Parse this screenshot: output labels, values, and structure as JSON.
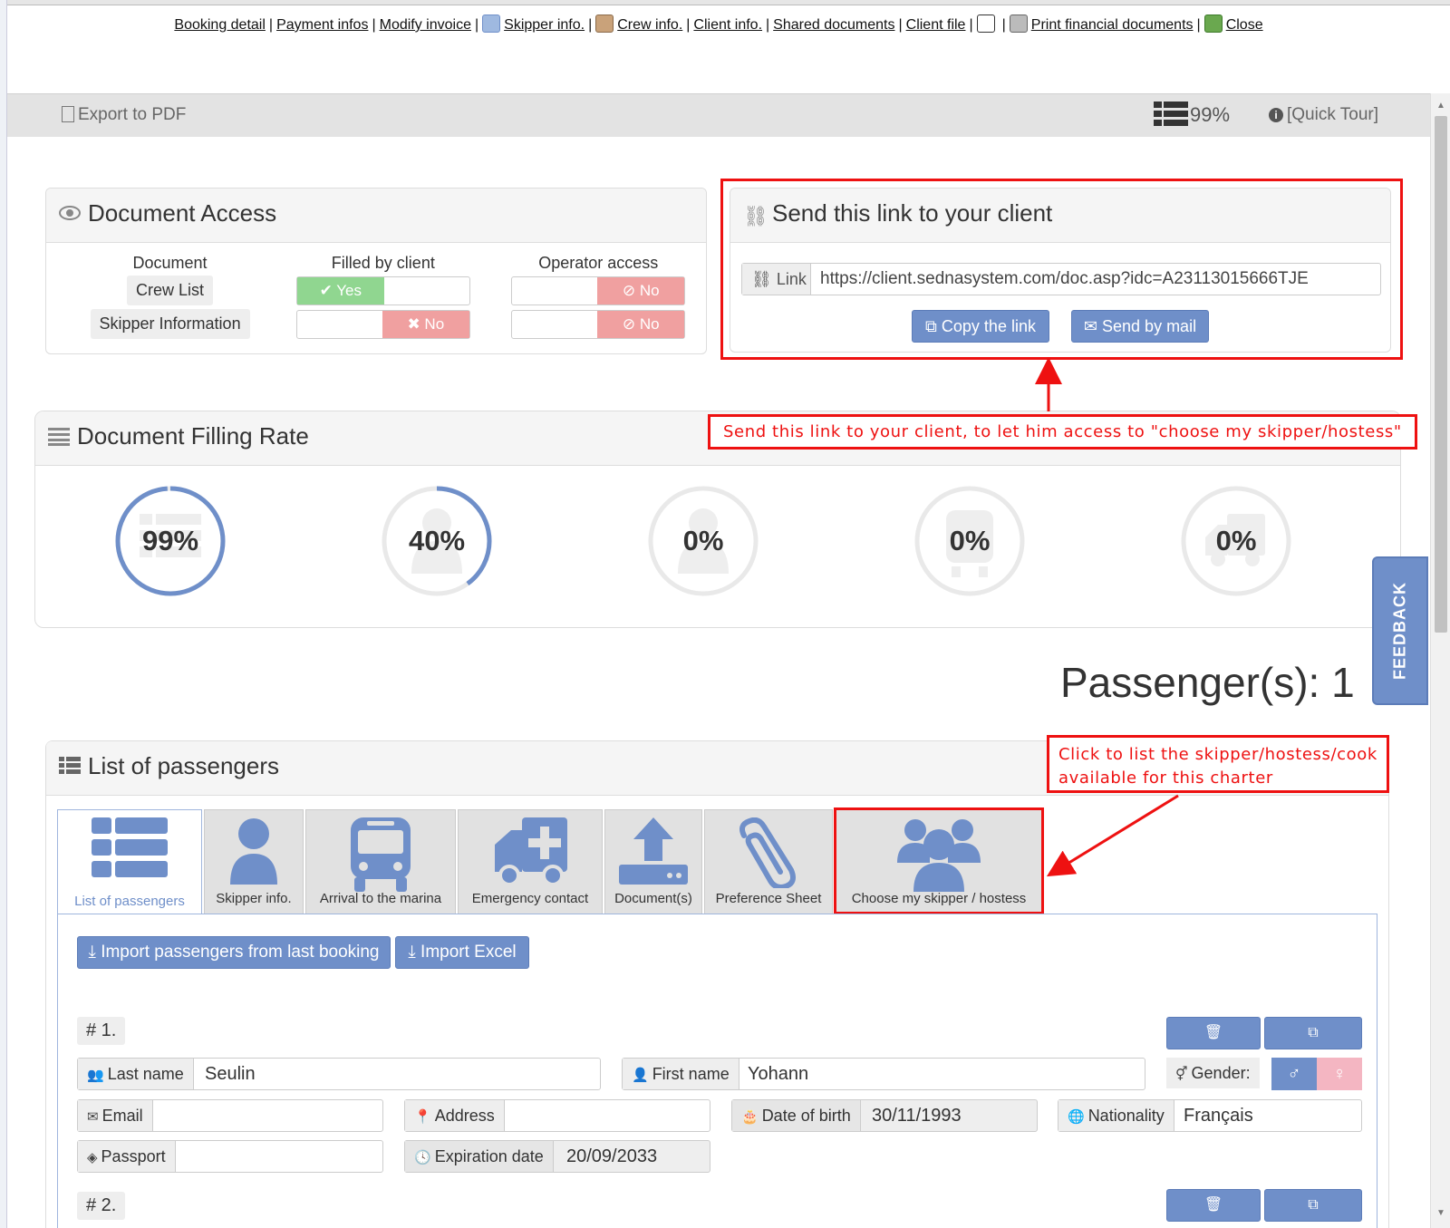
{
  "nav": {
    "booking_detail": "Booking detail",
    "payment_infos": "Payment infos",
    "modify_invoice": "Modify invoice",
    "skipper_info": "Skipper info.",
    "crew_info": "Crew info.",
    "client_info": "Client info.",
    "shared_documents": "Shared documents",
    "client_file": "Client file",
    "print_financial": "Print financial documents",
    "close": "Close",
    "sep": "|"
  },
  "toolbar": {
    "export_pdf": "Export to PDF",
    "fill_rate": "99%",
    "quick_tour": "[Quick Tour]"
  },
  "document_access": {
    "title": "Document Access",
    "headers": [
      "Document",
      "Filled by client",
      "Operator access"
    ],
    "rows": [
      {
        "document": "Crew List",
        "filled": "Yes",
        "filled_state": true,
        "operator": "No",
        "operator_state": false
      },
      {
        "document": "Skipper Information",
        "filled": "No",
        "filled_state": false,
        "operator": "No",
        "operator_state": false
      }
    ]
  },
  "send_link": {
    "title": "Send this link to your client",
    "link_label": "Link",
    "url": "https://client.sednasystem.com/doc.asp?idc=A23113015666TJE",
    "copy_button": "Copy the link",
    "mail_button": "Send by mail"
  },
  "annotations": {
    "send_link_note": "Send this link to your client, to let him access to \"choose my skipper/hostess\"",
    "choose_note_line1": "Click to list the skipper/hostess/cook",
    "choose_note_line2": "available for this charter",
    "color": "#e11111"
  },
  "filling_rate": {
    "title": "Document Filling Rate",
    "rings": [
      {
        "label": "99%",
        "value": 0.99,
        "icon": "list-icon"
      },
      {
        "label": "40%",
        "value": 0.4,
        "icon": "user-icon"
      },
      {
        "label": "0%",
        "value": 0,
        "icon": "user-icon"
      },
      {
        "label": "0%",
        "value": 0,
        "icon": "bus-icon"
      },
      {
        "label": "0%",
        "value": 0,
        "icon": "ambulance-icon"
      }
    ]
  },
  "passengers_count": "Passenger(s): 1",
  "feedback": "FEEDBACK",
  "list_of_passengers": {
    "title": "List of passengers",
    "tabs": [
      {
        "label": "List of passengers",
        "icon": "list-icon"
      },
      {
        "label": "Skipper info.",
        "icon": "user-icon"
      },
      {
        "label": "Arrival to the marina",
        "icon": "bus-icon"
      },
      {
        "label": "Emergency contact",
        "icon": "ambulance-icon"
      },
      {
        "label": "Document(s)",
        "icon": "upload-icon"
      },
      {
        "label": "Preference Sheet",
        "icon": "paperclip-icon"
      },
      {
        "label": "Choose my skipper / hostess",
        "icon": "users-icon"
      }
    ],
    "import_last_booking": "Import passengers from last booking",
    "import_excel": "Import Excel",
    "passenger1": {
      "number": "# 1.",
      "last_name_label": "Last name",
      "last_name": "Seulin",
      "first_name_label": "First name",
      "first_name": "Yohann",
      "gender_label": "Gender:",
      "email_label": "Email",
      "email": "",
      "address_label": "Address",
      "address": "",
      "dob_label": "Date of birth",
      "dob": "30/11/1993",
      "nationality_label": "Nationality",
      "nationality": "Français",
      "passport_label": "Passport",
      "passport": "",
      "expiration_label": "Expiration date",
      "expiration": "20/09/2033"
    },
    "passenger2_number": "# 2."
  },
  "colors": {
    "accent": "#6f8fc9",
    "yes_green": "#90d690",
    "no_red": "#f0a0a0"
  }
}
